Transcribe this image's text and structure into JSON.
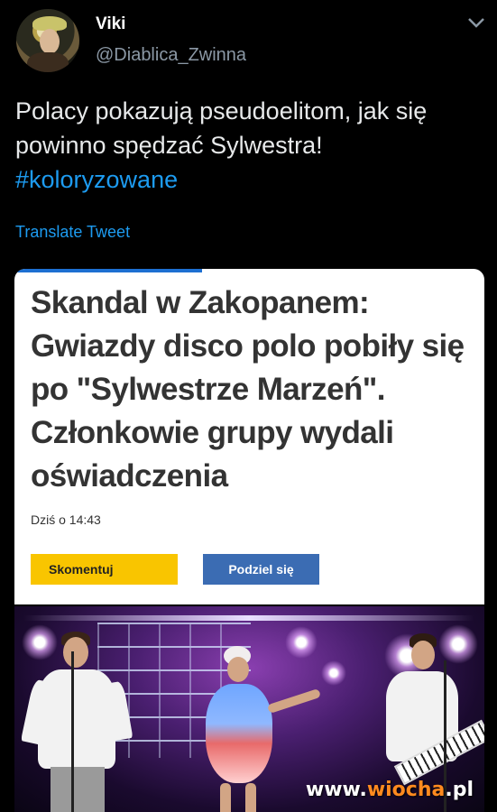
{
  "tweet": {
    "author_name": "Viki",
    "author_handle": "@Diablica_Zwinna",
    "text": "Polacy pokazują pseudoelitom, jak się powinno spędzać Sylwestra!",
    "hashtag": "#koloryzowane",
    "translate_label": "Translate Tweet"
  },
  "card": {
    "load_progress": 0.4,
    "headline": "Skandal w Zakopanem: Gwiazdy disco polo pobiły się po \"Sylwestrze Marzeń\". Członkowie grupy wydali oświadczenia",
    "timestamp": "Dziś o 14:43",
    "comment_button": "Skomentuj",
    "share_button": "Podziel się"
  },
  "photo": {
    "watermark_prefix": "www.",
    "watermark_brand": "wiocha",
    "watermark_suffix": ".pl"
  },
  "icons": {
    "more": "chevron-down-icon"
  },
  "colors": {
    "background": "#000000",
    "link": "#1d9bf0",
    "comment_button": "#f9c500",
    "share_button": "#3b6cb3",
    "watermark_accent": "#ff8a1f"
  }
}
